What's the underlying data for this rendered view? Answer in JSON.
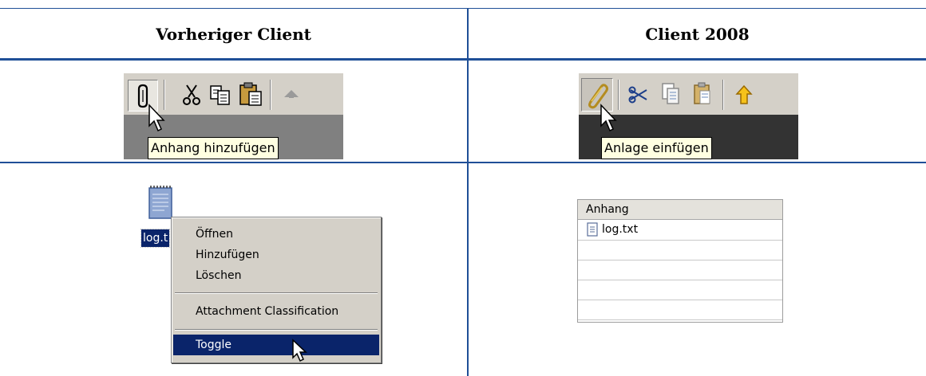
{
  "columns": {
    "previous": "Vorheriger Client",
    "current": "Client 2008"
  },
  "previous_client": {
    "toolbar_tooltip": "Anhang hinzufügen",
    "file_label": "log.t",
    "context_menu": [
      "Öffnen",
      "Hinzufügen",
      "Löschen",
      "Attachment Classification",
      "Toggle"
    ],
    "selected_item": "Toggle"
  },
  "client_2008": {
    "toolbar_tooltip": "Anlage einfügen",
    "attachment_column": "Anhang",
    "attachment_file": "log.txt"
  },
  "colors": {
    "rule": "#1f4f97",
    "menu_bg": "#d4d0c8",
    "menu_highlight": "#0a246a",
    "tooltip_bg": "#ffffe1",
    "toolbar_dark": "#333333"
  },
  "icons": [
    "paperclip-icon",
    "scissors-icon",
    "copy-icon",
    "paste-icon",
    "up-arrow-icon",
    "text-file-icon",
    "cursor-icon"
  ]
}
